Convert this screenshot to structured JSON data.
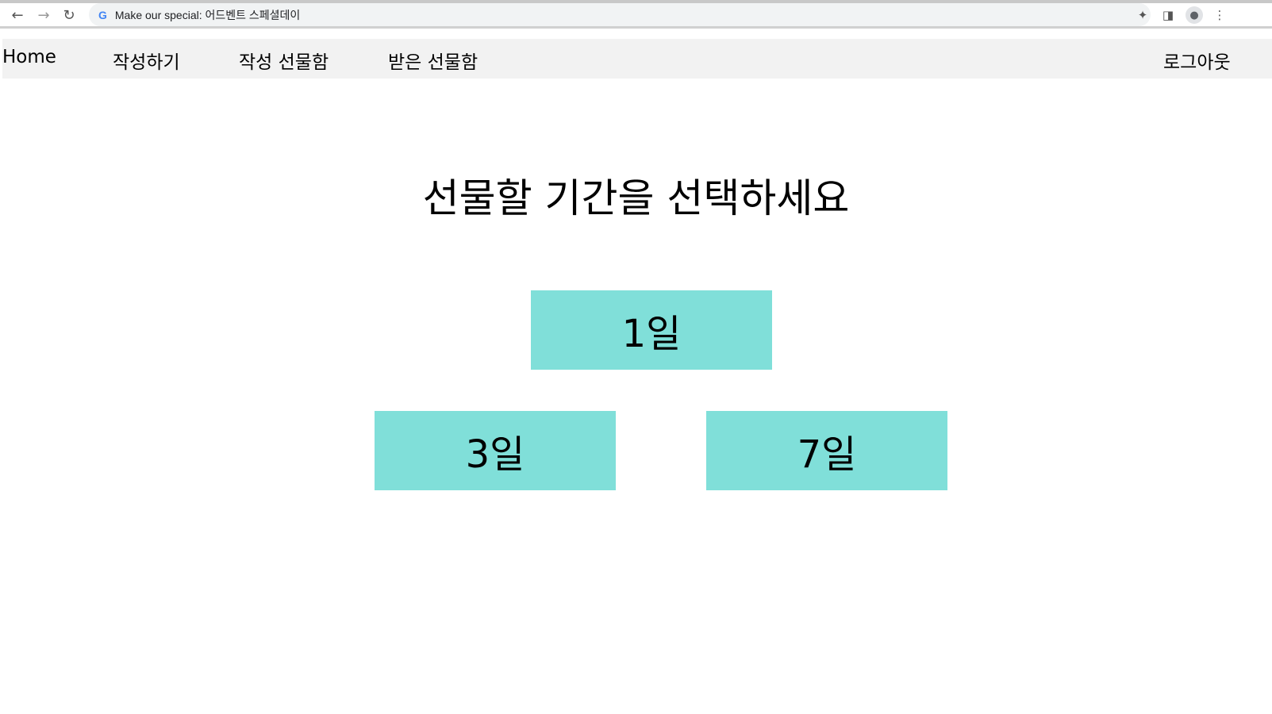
{
  "browser": {
    "back_icon": "arrow-left-icon",
    "forward_icon": "arrow-right-icon",
    "reload_icon": "reload-icon",
    "site_icon": "G",
    "url": "Make our special: 어드벤트 스페셜데이"
  },
  "navbar": {
    "home": "Home",
    "write": "작성하기",
    "written_box": "작성 선물함",
    "received_box": "받은 선물함",
    "logout": "로그아웃"
  },
  "main": {
    "title": "선물할 기간을 선택하세요",
    "options": {
      "one_day": "1일",
      "three_days": "3일",
      "seven_days": "7일"
    }
  },
  "colors": {
    "button_bg": "#80dfd9",
    "navbar_bg": "#f2f2f2"
  }
}
